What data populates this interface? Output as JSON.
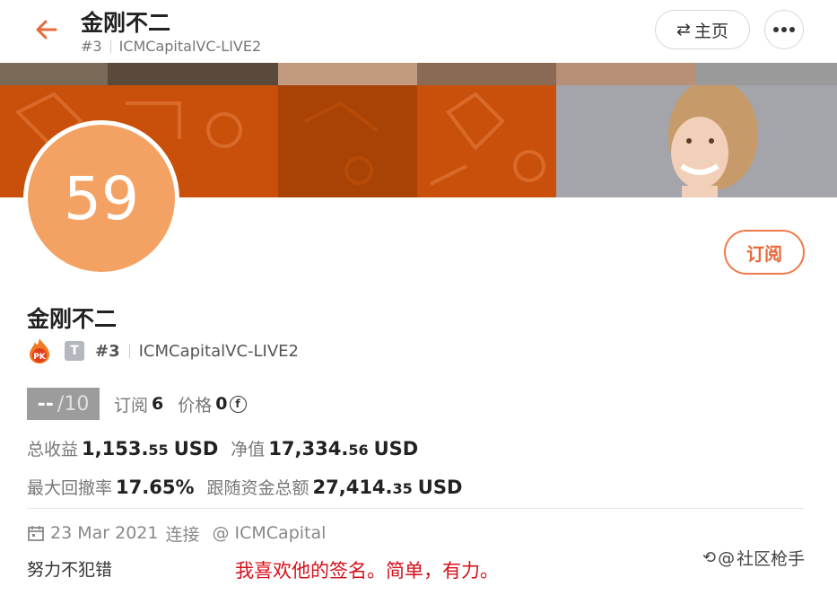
{
  "header": {
    "title": "金刚不二",
    "rank": "#3",
    "account": "ICMCapitalVC-LIVE2",
    "home_label": "主页"
  },
  "profile": {
    "avatar_number": "59",
    "name": "金刚不二",
    "pk_label": "PK",
    "type_badge": "T",
    "rank": "#3",
    "account": "ICMCapitalVC-LIVE2",
    "subscribe_label": "订阅"
  },
  "stats": {
    "score": "--",
    "score_denominator": "/10",
    "subscribers_label": "订阅",
    "subscribers": "6",
    "price_label": "价格",
    "price": "0",
    "price_coin": "f",
    "total_profit_label": "总收益",
    "total_profit_main": "1,153.",
    "total_profit_dec": "55",
    "net_value_label": "净值",
    "net_value_main": "17,334.",
    "net_value_dec": "56",
    "max_drawdown_label": "最大回撤率",
    "max_drawdown": "17.65%",
    "follow_funds_label": "跟随资金总额",
    "follow_funds_main": "27,414.",
    "follow_funds_dec": "35",
    "currency": "USD"
  },
  "meta": {
    "date": "23 Mar 2021",
    "connect_label": "连接",
    "broker": "@ ICMCapital"
  },
  "signature": "努力不犯错",
  "annotation": "我喜欢他的签名。简单，有力。",
  "watermark": "社区枪手",
  "colors": {
    "accent": "#e86a3a",
    "banner_orange": "#c9500a",
    "avatar": "#f4a263",
    "annotation": "#d6101a"
  }
}
